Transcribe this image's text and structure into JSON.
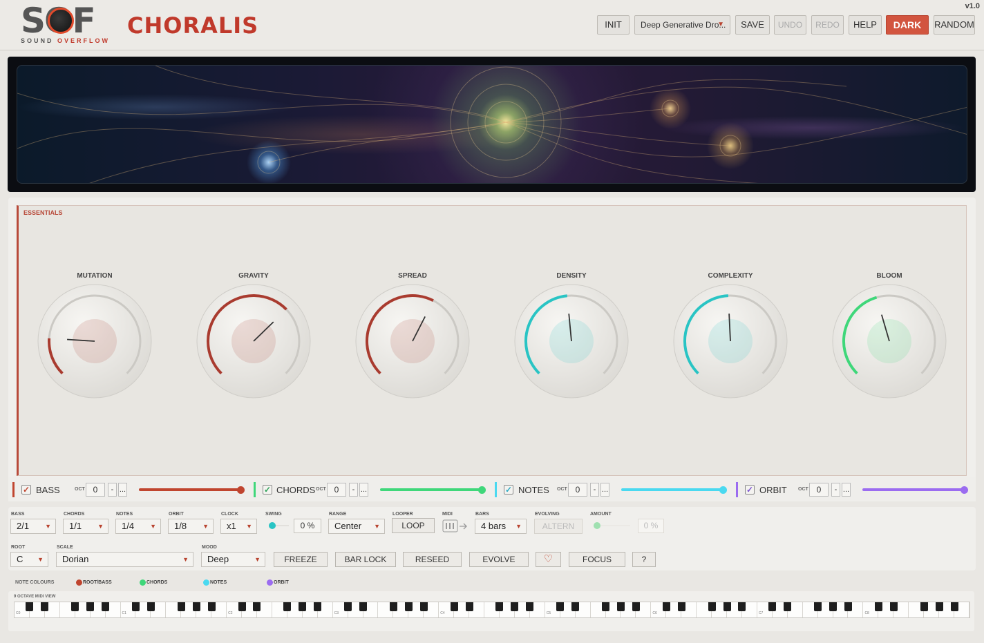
{
  "header": {
    "logo_text": "SOF",
    "brand_word1": "SOUND",
    "brand_word2": "OVERFLOW",
    "product_name": "CHORALIS",
    "version": "v1.0",
    "buttons": {
      "init": "INIT",
      "preset_name": "Deep Generative Dro...",
      "save": "SAVE",
      "undo": "UNDO",
      "redo": "REDO",
      "help": "HELP",
      "dark": "DARK",
      "random": "RANDOM"
    }
  },
  "essentials": {
    "title": "ESSENTIALS",
    "knobs": [
      {
        "label": "MUTATION",
        "value": 0.18,
        "color": "#a93b2f"
      },
      {
        "label": "GRAVITY",
        "value": 0.67,
        "color": "#a93b2f"
      },
      {
        "label": "SPREAD",
        "value": 0.6,
        "color": "#a93b2f"
      },
      {
        "label": "DENSITY",
        "value": 0.48,
        "color": "#29c4c4"
      },
      {
        "label": "COMPLEXITY",
        "value": 0.49,
        "color": "#29c4c4"
      },
      {
        "label": "BLOOM",
        "value": 0.44,
        "color": "#3fd77a"
      }
    ]
  },
  "layers": [
    {
      "name": "BASS",
      "enabled": true,
      "oct_label": "OCT",
      "octave": "0",
      "minus": "-",
      "more": "...",
      "volume": 1.0,
      "color": "#c0452f"
    },
    {
      "name": "CHORDS",
      "enabled": true,
      "oct_label": "OCT",
      "octave": "0",
      "minus": "-",
      "more": "...",
      "volume": 1.0,
      "color": "#3fd77a"
    },
    {
      "name": "NOTES",
      "enabled": true,
      "oct_label": "OCT",
      "octave": "0",
      "minus": "-",
      "more": "...",
      "volume": 1.0,
      "color": "#4ad9f0"
    },
    {
      "name": "ORBIT",
      "enabled": true,
      "oct_label": "OCT",
      "octave": "0",
      "minus": "-",
      "more": "...",
      "volume": 1.0,
      "color": "#9b6cf0"
    }
  ],
  "controls": {
    "bass": {
      "label": "BASS",
      "value": "2/1"
    },
    "chords": {
      "label": "CHORDS",
      "value": "1/1"
    },
    "notes": {
      "label": "NOTES",
      "value": "1/4"
    },
    "orbit": {
      "label": "ORBIT",
      "value": "1/8"
    },
    "clock": {
      "label": "CLOCK",
      "value": "x1"
    },
    "swing": {
      "label": "SWING",
      "value": "0 %",
      "color": "#29c4c4"
    },
    "range": {
      "label": "RANGE",
      "value": "Center"
    },
    "looper": {
      "label": "LOOPER",
      "button": "LOOP"
    },
    "midi": {
      "label": "MIDI",
      "icon": "midi-drag-icon"
    },
    "bars": {
      "label": "BARS",
      "value": "4 bars"
    },
    "evolving": {
      "label": "EVOLVING",
      "value": "ALTERN"
    },
    "amount": {
      "label": "AMOUNT",
      "value": "0 %",
      "color": "#9fe0b0"
    },
    "root": {
      "label": "ROOT",
      "value": "C"
    },
    "scale": {
      "label": "SCALE",
      "value": "Dorian"
    },
    "mood": {
      "label": "MOOD",
      "value": "Deep"
    },
    "freeze": "FREEZE",
    "bar_lock": "BAR LOCK",
    "reseed": "RESEED",
    "evolve": "EVOLVE",
    "favorite_icon": "heart-icon",
    "focus": "FOCUS",
    "help_q": "?"
  },
  "note_colours": {
    "label": "NOTE COLOURS",
    "items": [
      {
        "label": "ROOT/BASS",
        "color": "#c0452f"
      },
      {
        "label": "CHORDS",
        "color": "#3fd77a"
      },
      {
        "label": "NOTES",
        "color": "#4ad9f0"
      },
      {
        "label": "ORBIT",
        "color": "#9b6cf0"
      }
    ]
  },
  "keyboard": {
    "title": "9 OCTAVE MIDI VIEW",
    "octave_labels": [
      "C0",
      "C1",
      "C2",
      "C3",
      "C4",
      "C5",
      "C6",
      "C7",
      "C8"
    ]
  }
}
